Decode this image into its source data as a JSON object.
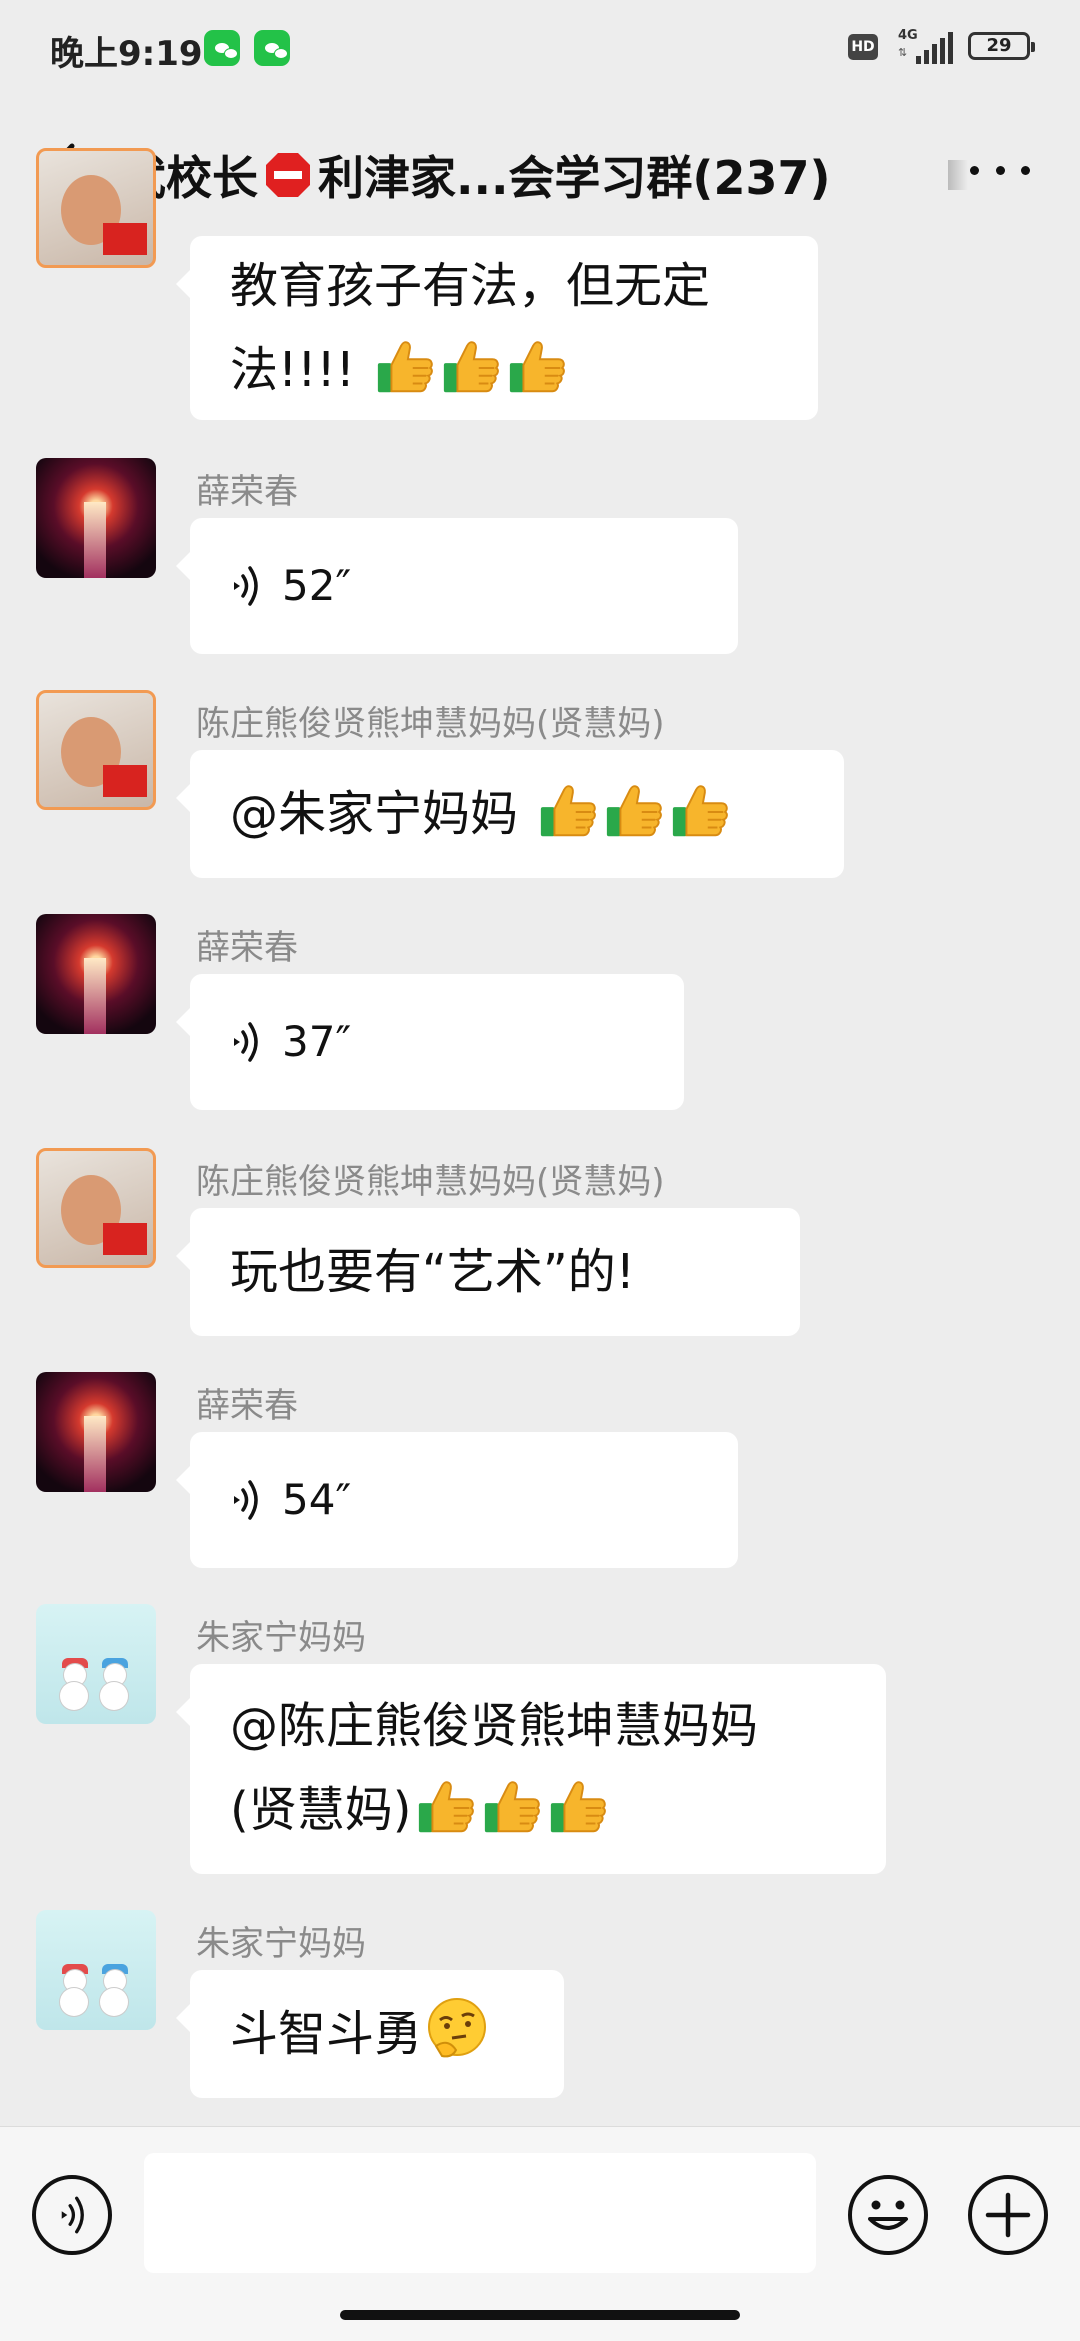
{
  "status_bar": {
    "time": "晚上9:19",
    "network_type": "4G",
    "hd_label": "HD",
    "battery_level": "29"
  },
  "header": {
    "title_prefix": "武校长",
    "title_suffix": "利津家...会学习群(237)"
  },
  "messages": [
    {
      "sender": "",
      "avatar": "child",
      "type": "text",
      "text": "教育孩子有法，但无定",
      "text_line2": "法!!!!",
      "emoji": [
        "thumbs-up",
        "thumbs-up",
        "thumbs-up"
      ]
    },
    {
      "sender": "薛荣春",
      "avatar": "fireworks",
      "type": "voice",
      "duration": "52″"
    },
    {
      "sender": "陈庄熊俊贤熊坤慧妈妈(贤慧妈)",
      "avatar": "child",
      "type": "text",
      "text": "@朱家宁妈妈 ",
      "emoji": [
        "thumbs-up",
        "thumbs-up",
        "thumbs-up"
      ]
    },
    {
      "sender": "薛荣春",
      "avatar": "fireworks",
      "type": "voice",
      "duration": "37″"
    },
    {
      "sender": "陈庄熊俊贤熊坤慧妈妈(贤慧妈)",
      "avatar": "child",
      "type": "text",
      "text": "玩也要有“艺术”的!"
    },
    {
      "sender": "薛荣春",
      "avatar": "fireworks",
      "type": "voice",
      "duration": "54″"
    },
    {
      "sender": "朱家宁妈妈",
      "avatar": "snowmen",
      "type": "text",
      "text": "@陈庄熊俊贤熊坤慧妈妈",
      "text_line2": "(贤慧妈)",
      "emoji": [
        "thumbs-up",
        "thumbs-up",
        "thumbs-up"
      ]
    },
    {
      "sender": "朱家宁妈妈",
      "avatar": "snowmen",
      "type": "text",
      "text": "斗智斗勇",
      "emoji": [
        "thinking-face"
      ]
    }
  ],
  "input_bar": {
    "icons": [
      "voice-input-icon",
      "emoji-icon",
      "plus-icon"
    ],
    "input_value": ""
  },
  "colors": {
    "background": "#ededed",
    "bubble": "#ffffff",
    "sender_name": "#8a8a8a",
    "wechat_green": "#23c248",
    "stop_red": "#e02020"
  }
}
